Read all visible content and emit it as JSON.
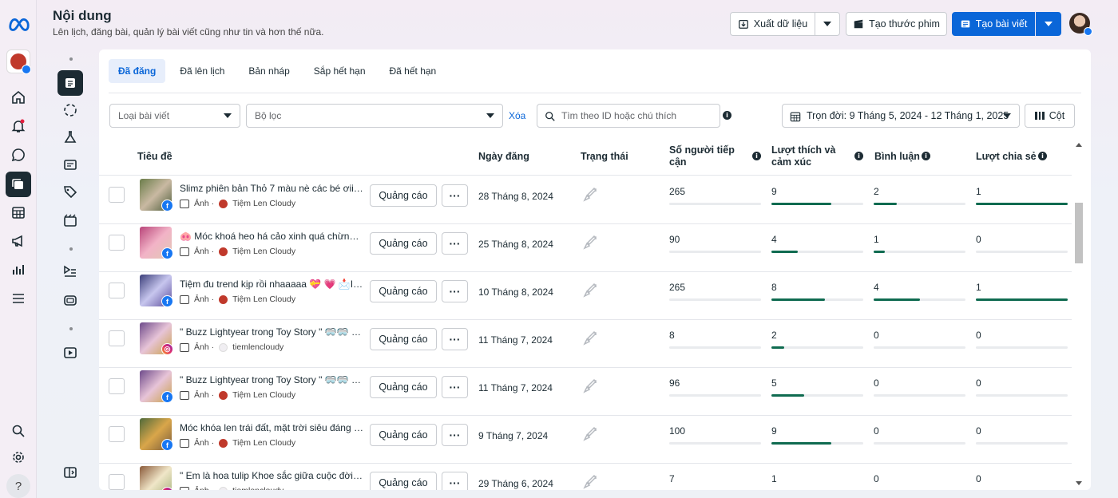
{
  "page": {
    "title": "Nội dung",
    "subtitle": "Lên lịch, đăng bài, quản lý bài viết cũng như tin và hơn thế nữa."
  },
  "toolbar": {
    "export_label": "Xuất dữ liệu",
    "create_reel_label": "Tạo thước phim",
    "create_post_label": "Tạo bài viết"
  },
  "tabs": [
    {
      "label": "Đã đăng",
      "active": true
    },
    {
      "label": "Đã lên lịch"
    },
    {
      "label": "Bản nháp"
    },
    {
      "label": "Sắp hết hạn"
    },
    {
      "label": "Đã hết hạn"
    }
  ],
  "filters": {
    "post_type_placeholder": "Loại bài viết",
    "filter_placeholder": "Bộ lọc",
    "clear_label": "Xóa",
    "search_placeholder": "Tìm theo ID hoặc chú thích",
    "date_range": "Trọn đời: 9 Tháng 5, 2024 - 12 Tháng 1, 2025",
    "columns_label": "Cột"
  },
  "columns": {
    "title": "Tiêu đề",
    "date": "Ngày đăng",
    "status": "Trạng thái",
    "reach": "Số người tiếp cận",
    "reactions": "Lượt thích và cảm xúc",
    "comments": "Bình luận",
    "shares": "Lượt chia sẻ"
  },
  "row_labels": {
    "ad_button": "Quảng cáo",
    "more": "···",
    "media_type": "Ảnh ·"
  },
  "colors": {
    "accent": "#0a66d8",
    "bar_fill": "#0f6b50",
    "facebook": "#1877f2"
  },
  "posts": [
    {
      "title": "Slimz phiên bản Thỏ 7 màu nè các bé ơiiii ...",
      "platform": "facebook",
      "page": "Tiệm Len Cloudy",
      "date": "28 Tháng 8, 2024",
      "reach": "265",
      "reach_fill": 0.0,
      "reactions": "9",
      "reactions_fill": 0.65,
      "comments": "2",
      "comments_fill": 0.25,
      "shares": "1",
      "shares_fill": 1.0
    },
    {
      "title": "🐽 Móc khoá heo há cảo xinh quá chừng lu...",
      "platform": "facebook",
      "page": "Tiệm Len Cloudy",
      "date": "25 Tháng 8, 2024",
      "reach": "90",
      "reach_fill": 0.0,
      "reactions": "4",
      "reactions_fill": 0.29,
      "comments": "1",
      "comments_fill": 0.12,
      "shares": "0",
      "shares_fill": 0.0
    },
    {
      "title": "Tiệm đu trend kịp rồi nhaaaaa 💝 💗 📩Inb...",
      "platform": "facebook",
      "page": "Tiệm Len Cloudy",
      "date": "10 Tháng 8, 2024",
      "reach": "265",
      "reach_fill": 0.0,
      "reactions": "8",
      "reactions_fill": 0.58,
      "comments": "4",
      "comments_fill": 0.5,
      "shares": "1",
      "shares_fill": 1.0
    },
    {
      "title": "\" Buzz Lightyear trong Toy Story \" 🥽🥽 Đâ...",
      "platform": "instagram",
      "page": "tiemlencloudy",
      "date": "11 Tháng 7, 2024",
      "reach": "8",
      "reach_fill": 0.0,
      "reactions": "2",
      "reactions_fill": 0.14,
      "comments": "0",
      "comments_fill": 0.0,
      "shares": "0",
      "shares_fill": 0.0
    },
    {
      "title": "\" Buzz Lightyear trong Toy Story \" 🥽🥽 Đâ...",
      "platform": "facebook",
      "page": "Tiệm Len Cloudy",
      "date": "11 Tháng 7, 2024",
      "reach": "96",
      "reach_fill": 0.0,
      "reactions": "5",
      "reactions_fill": 0.36,
      "comments": "0",
      "comments_fill": 0.0,
      "shares": "0",
      "shares_fill": 0.0
    },
    {
      "title": "Móc khóa len trái đất, mặt trời siêu đáng yê...",
      "platform": "facebook",
      "page": "Tiệm Len Cloudy",
      "date": "9 Tháng 7, 2024",
      "reach": "100",
      "reach_fill": 0.0,
      "reactions": "9",
      "reactions_fill": 0.65,
      "comments": "0",
      "comments_fill": 0.0,
      "shares": "0",
      "shares_fill": 0.0
    },
    {
      "title": "\" Em là hoa tulip Khoe sắc giữa cuộc đời, An...",
      "platform": "instagram",
      "page": "tiemlencloudy",
      "date": "29 Tháng 6, 2024",
      "reach": "7",
      "reach_fill": 0.0,
      "reactions": "1",
      "reactions_fill": 0.07,
      "comments": "0",
      "comments_fill": 0.0,
      "shares": "0",
      "shares_fill": 0.0
    }
  ]
}
